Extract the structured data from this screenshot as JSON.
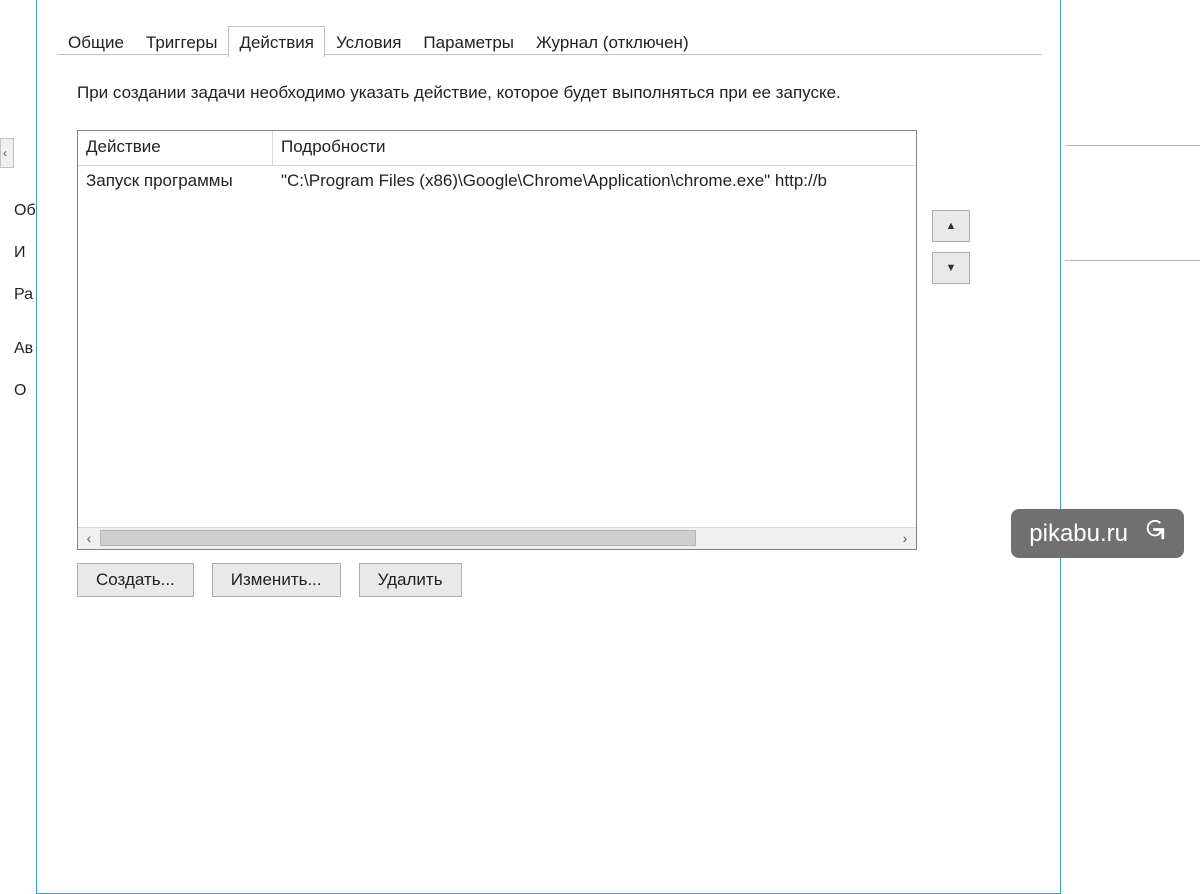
{
  "bg": {
    "labels": [
      "Об",
      "И",
      "Ра",
      "Ав",
      "О"
    ]
  },
  "tabs": {
    "general": "Общие",
    "triggers": "Триггеры",
    "actions": "Действия",
    "conditions": "Условия",
    "settings": "Параметры",
    "history": "Журнал (отключен)"
  },
  "active_tab": "actions",
  "description": "При создании задачи необходимо указать действие, которое будет выполняться при ее запуске.",
  "list": {
    "columns": {
      "action": "Действие",
      "details": "Подробности"
    },
    "rows": [
      {
        "action": "Запуск программы",
        "details": "\"C:\\Program Files (x86)\\Google\\Chrome\\Application\\chrome.exe\" http://b"
      }
    ]
  },
  "buttons": {
    "create": "Создать...",
    "edit": "Изменить...",
    "delete": "Удалить",
    "up_glyph": "▲",
    "down_glyph": "▼",
    "scroll_left_glyph": "‹",
    "scroll_right_glyph": "›"
  },
  "watermark": {
    "text": "pikabu.ru"
  }
}
